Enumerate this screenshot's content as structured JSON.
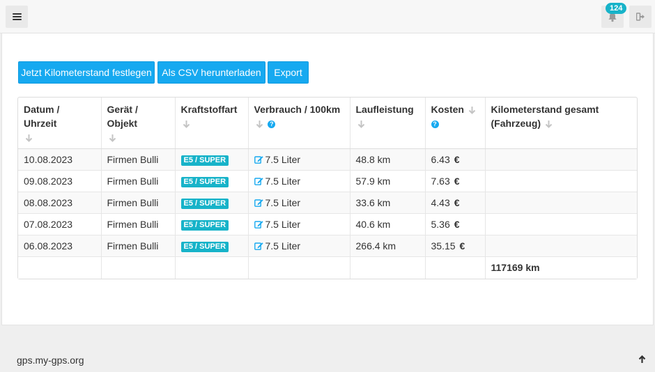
{
  "topbar": {
    "notifications_count": "124"
  },
  "icons": {
    "menu": "hamburger-icon",
    "bell": "bell-icon",
    "logout": "sign-out-icon",
    "sort": "arrow-down-icon",
    "help": "question-circle-icon",
    "edit": "edit-icon",
    "scroll_top": "arrow-up-icon"
  },
  "colors": {
    "primary_button": "#16a9f0",
    "badge": "#17b3c9",
    "help_icon": "#16a9f0",
    "edit_icon": "#16a9f0"
  },
  "toolbar": {
    "set_mileage_label": "Jetzt Kilometerstand festlegen",
    "csv_label": "Als CSV herunterladen",
    "export_label": "Export"
  },
  "table": {
    "headers": {
      "datetime": "Datum / Uhrzeit",
      "device": "Gerät / Objekt",
      "fuel": "Kraftstoffart",
      "consumption": "Verbrauch / 100km",
      "distance": "Laufleistung",
      "cost": "Kosten",
      "mileage_line1": "Kilometerstand gesamt",
      "mileage_line2": "(Fahrzeug)"
    },
    "help_glyph": "?",
    "currency": "€",
    "rows": [
      {
        "date": "10.08.2023",
        "device": "Firmen Bulli",
        "fuel": "E5 / SUPER",
        "consumption": "7.5 Liter",
        "distance": "48.8 km",
        "cost": "6.43",
        "mileage": ""
      },
      {
        "date": "09.08.2023",
        "device": "Firmen Bulli",
        "fuel": "E5 / SUPER",
        "consumption": "7.5 Liter",
        "distance": "57.9 km",
        "cost": "7.63",
        "mileage": ""
      },
      {
        "date": "08.08.2023",
        "device": "Firmen Bulli",
        "fuel": "E5 / SUPER",
        "consumption": "7.5 Liter",
        "distance": "33.6 km",
        "cost": "4.43",
        "mileage": ""
      },
      {
        "date": "07.08.2023",
        "device": "Firmen Bulli",
        "fuel": "E5 / SUPER",
        "consumption": "7.5 Liter",
        "distance": "40.6 km",
        "cost": "5.36",
        "mileage": ""
      },
      {
        "date": "06.08.2023",
        "device": "Firmen Bulli",
        "fuel": "E5 / SUPER",
        "consumption": "7.5 Liter",
        "distance": "266.4 km",
        "cost": "35.15",
        "mileage": ""
      }
    ],
    "total_mileage": "117169 km"
  },
  "footer": {
    "site": "gps.my-gps.org"
  }
}
